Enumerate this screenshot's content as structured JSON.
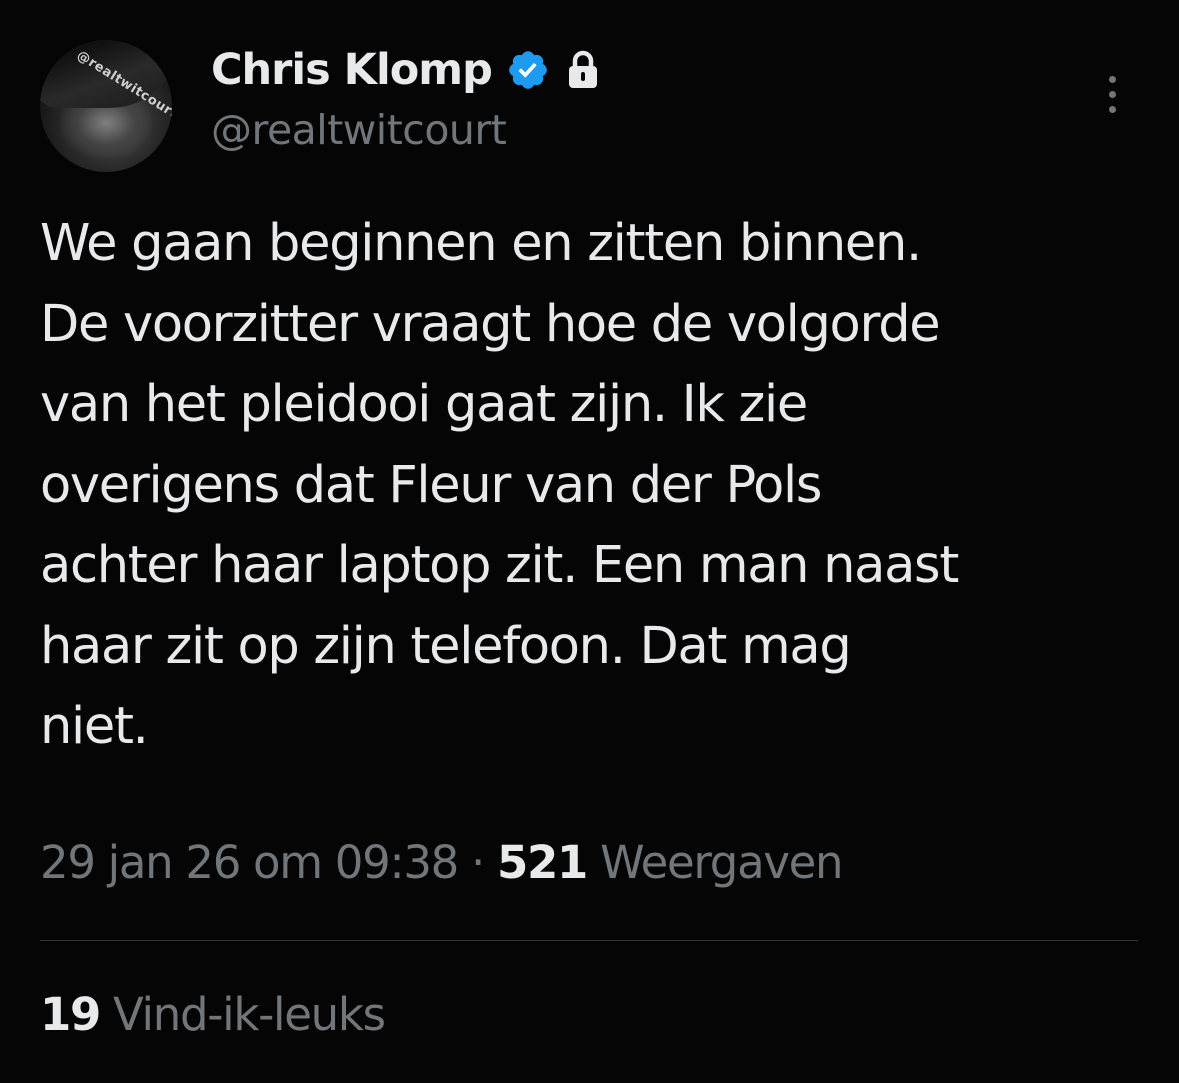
{
  "author": {
    "display_name": "Chris Klomp",
    "handle": "@realtwitcourt",
    "avatar_label": "@realtwitcourt",
    "verified": true,
    "protected": true,
    "verified_icon": "verified-badge-icon",
    "lock_icon": "lock-icon"
  },
  "menu": {
    "icon": "more-options-icon"
  },
  "tweet": {
    "text": "We gaan beginnen en zitten binnen.\nDe voorzitter vraagt hoe de volgorde\nvan het pleidooi gaat zijn. Ik zie\noverigens dat Fleur van der Pols\nachter haar laptop zit. Een man naast\nhaar zit op zijn telefoon. Dat mag\nniet.",
    "timestamp": "29 jan 26 om 09:38",
    "separator": " · ",
    "views_count": "521",
    "views_label": " Weergaven"
  },
  "stats": {
    "likes_count": "19",
    "likes_label": " Vind-ik-leuks"
  },
  "colors": {
    "background": "#050505",
    "text": "#e7e9ea",
    "secondary": "#71767b",
    "verified": "#1d9bf0",
    "divider": "#2f3336"
  }
}
